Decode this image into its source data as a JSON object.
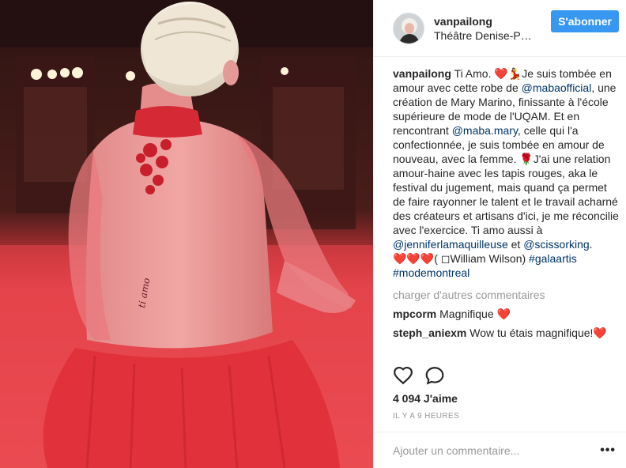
{
  "header": {
    "username": "vanpailong",
    "location": "Théâtre Denise-P…",
    "follow_label": "S'abonner"
  },
  "caption": {
    "username": "vanpailong",
    "t1": " Ti Amo. ",
    "e1": "❤️💃",
    "t2": "Je suis tombée en amour avec cette robe de ",
    "m1": "@mabaofficial",
    "t3": ", une création de Mary Marino, finissante à l'école supérieure de mode de l'UQAM. Et en rencontrant ",
    "m2": "@maba.mary",
    "t4": ", celle qui l'a confectionnée, je suis tombée en amour de nouveau, avec la femme. ",
    "e2": "🌹",
    "t5": "J'ai une relation amour-haine avec les tapis rouges, aka le festival du jugement, mais quand ça permet de faire rayonner le talent et le travail acharné des créateurs et artisans d'ici, je me réconcilie avec l'exercice. Ti amo aussi à ",
    "m3": "@jenniferlamaquilleuse",
    "t6": " et ",
    "m4": "@scissorking",
    "t7": ".",
    "e3": "❤️❤️❤️",
    "t8": "( ",
    "e4": "◻",
    "t9": "William Wilson) ",
    "h1": "#galaartis",
    "h2": "#modemontreal"
  },
  "more_comments_label": "charger d'autres commentaires",
  "comments": [
    {
      "username": "mpcorm",
      "text": " Magnifique ",
      "emoji": "❤️"
    },
    {
      "username": "steph_aniexm",
      "text": " Wow tu étais magnifique!",
      "emoji": "❤️"
    }
  ],
  "actions": {
    "like_icon": "heart-outline-icon",
    "comment_icon": "speech-bubble-icon"
  },
  "likes_label": "4 094 J'aime",
  "timestamp": "IL Y A 9 HEURES",
  "add_comment": {
    "placeholder": "Ajouter un commentaire...",
    "more_icon": "•••"
  },
  "colors": {
    "accent": "#3897f0",
    "link": "#003569",
    "muted": "#999999",
    "heart": "#ed4956"
  }
}
